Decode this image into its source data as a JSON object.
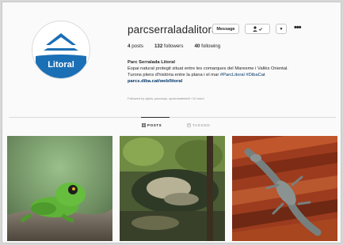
{
  "profile": {
    "username": "parcserraladalitoral",
    "avatar_text": "Litoral",
    "buttons": {
      "message": "Message",
      "follow_icon": "person-check-icon",
      "dropdown": "▾",
      "more": "•••"
    },
    "stats": {
      "posts_count": "4",
      "posts_label": "posts",
      "followers_count": "132",
      "followers_label": "followers",
      "following_count": "40",
      "following_label": "following"
    },
    "bio": {
      "name": "Parc Serralada Litoral",
      "line1": "Espai natural protegit situat entre les comarques del Maresme i Vallès Oriental.",
      "line2_text": "Turons plens d'història entre la plana i el mar ",
      "hashtags": "#ParcLitoral #DibaCat",
      "website": "parcs.diba.cat/web/litoral"
    },
    "followed_by": "Followed by ajiela, parcsiojo, apromiadetabit +15 more"
  },
  "tabs": [
    {
      "label": "POSTS",
      "icon": "grid-icon",
      "active": true
    },
    {
      "label": "TAGGED",
      "icon": "tag-icon",
      "active": false
    }
  ],
  "posts": [
    {
      "subject": "frog-photo"
    },
    {
      "subject": "stream-photo"
    },
    {
      "subject": "gecko-photo"
    }
  ],
  "colors": {
    "brand_blue": "#1b6fb5",
    "link": "#003569",
    "muted": "#8e8e8e",
    "border": "#dbdbdb"
  }
}
